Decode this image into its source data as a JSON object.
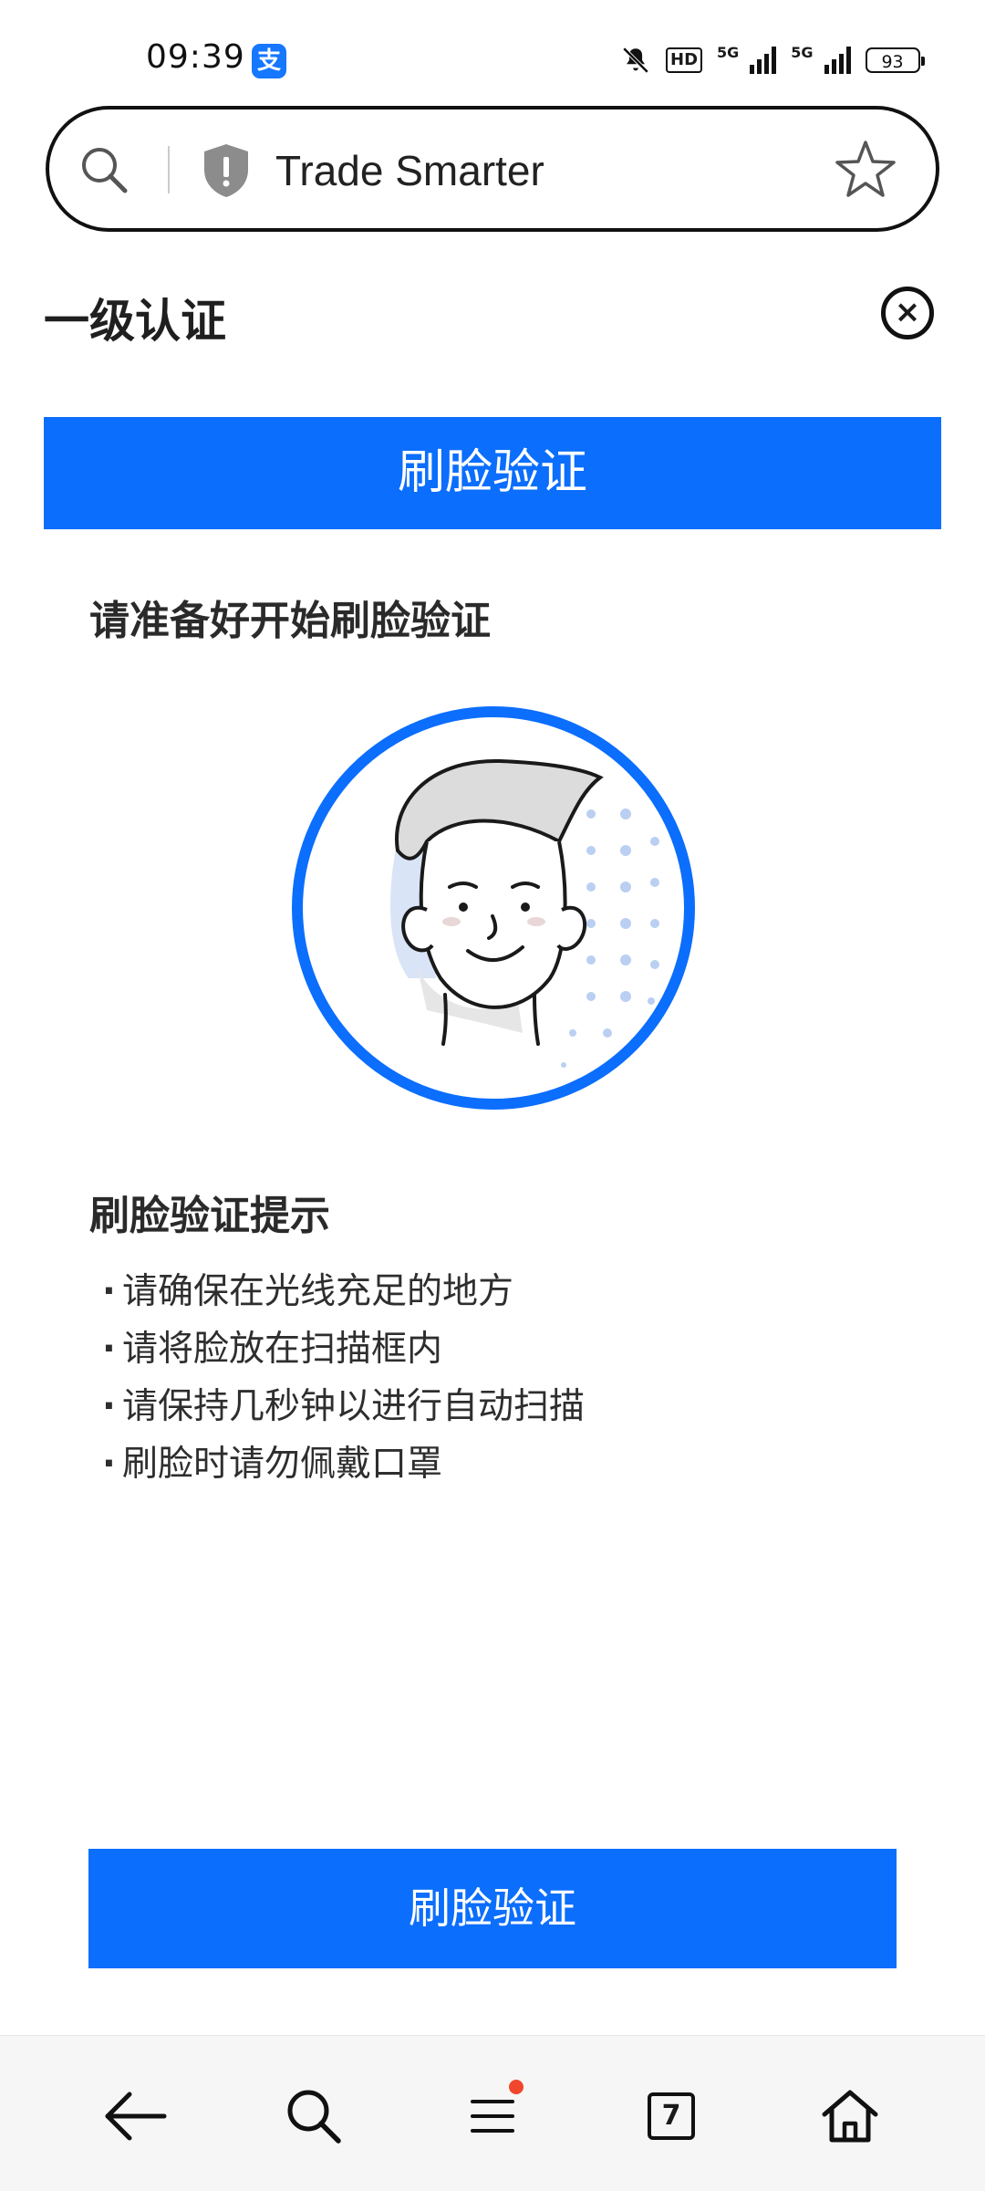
{
  "status_bar": {
    "time": "09:39",
    "app_icon": "alipay-icon",
    "hd_label": "HD",
    "net1_label": "5G",
    "net2_label": "5G",
    "battery": "93"
  },
  "browser": {
    "site_title": "Trade Smarter",
    "tab_count": "7"
  },
  "page": {
    "level_title": "一级认证",
    "banner_title": "刷脸验证",
    "ready_text": "请准备好开始刷脸验证",
    "tips_title": "刷脸验证提示",
    "tips": [
      "请确保在光线充足的地方",
      "请将脸放在扫描框内",
      "请保持几秒钟以进行自动扫描",
      "刷脸时请勿佩戴口罩"
    ],
    "verify_button": "刷脸验证"
  },
  "colors": {
    "primary": "#0b6efd",
    "badge_red": "#f0472c"
  }
}
